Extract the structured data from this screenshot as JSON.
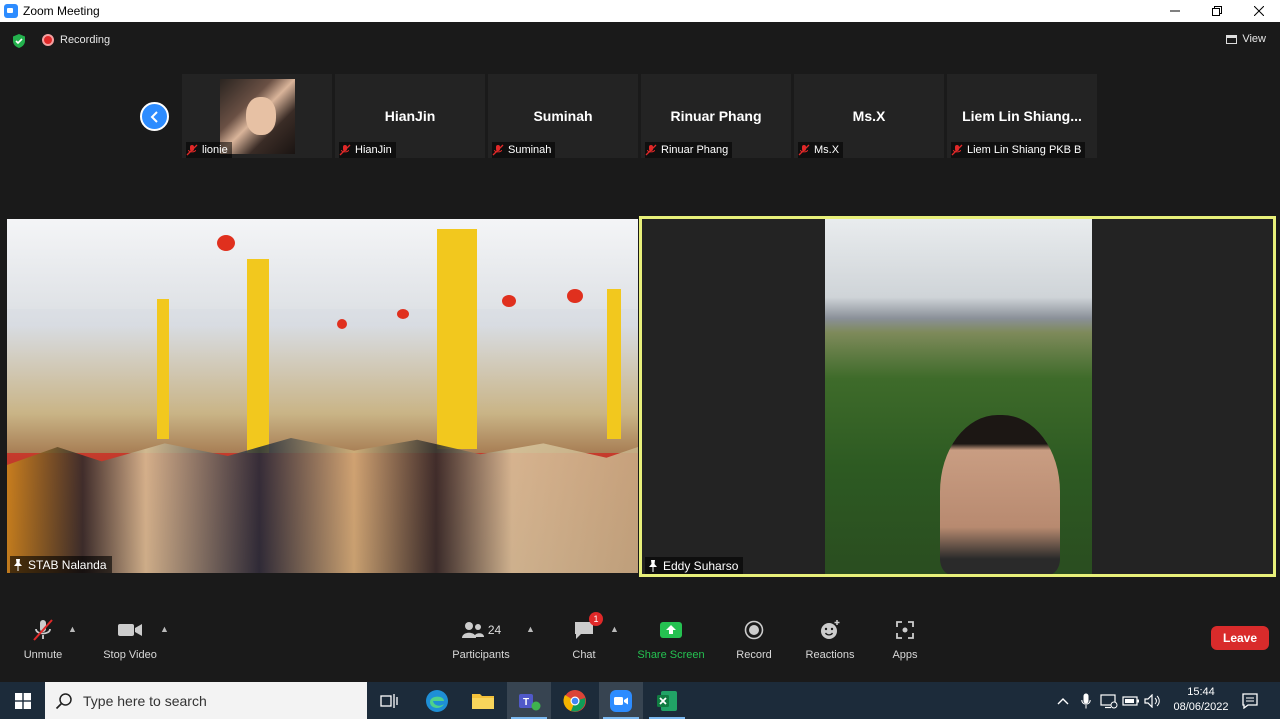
{
  "window": {
    "title": "Zoom Meeting",
    "controls": [
      "minimize",
      "restore",
      "close"
    ]
  },
  "meeting_top": {
    "recording_label": "Recording",
    "view_label": "View"
  },
  "participants_strip": [
    {
      "tile_name": "",
      "label": "lionie",
      "muted": true,
      "has_photo": true
    },
    {
      "tile_name": "HianJin",
      "label": "HianJin",
      "muted": true
    },
    {
      "tile_name": "Suminah",
      "label": "Suminah",
      "muted": true
    },
    {
      "tile_name": "Rinuar Phang",
      "label": "Rinuar Phang",
      "muted": true
    },
    {
      "tile_name": "Ms.X",
      "label": "Ms.X",
      "muted": true
    },
    {
      "tile_name": "Liem Lin Shiang...",
      "label": "Liem Lin Shiang PKB B",
      "muted": true
    }
  ],
  "main_videos": [
    {
      "label": "STAB Nalanda",
      "active_speaker": false
    },
    {
      "label": "Eddy Suharso",
      "active_speaker": true,
      "highlight_color": "#e8f07a"
    }
  ],
  "toolbar": {
    "unmute": "Unmute",
    "stop_video": "Stop Video",
    "participants": "Participants",
    "participants_count": "24",
    "chat": "Chat",
    "chat_badge": "1",
    "share_screen": "Share Screen",
    "record": "Record",
    "reactions": "Reactions",
    "apps": "Apps",
    "leave": "Leave"
  },
  "taskbar": {
    "search_placeholder": "Type here to search",
    "time": "15:44",
    "date": "08/06/2022"
  },
  "colors": {
    "accent": "#2d8cff",
    "leave": "#d92b2b",
    "share": "#25c151",
    "speaker_border": "#e8f07a"
  }
}
